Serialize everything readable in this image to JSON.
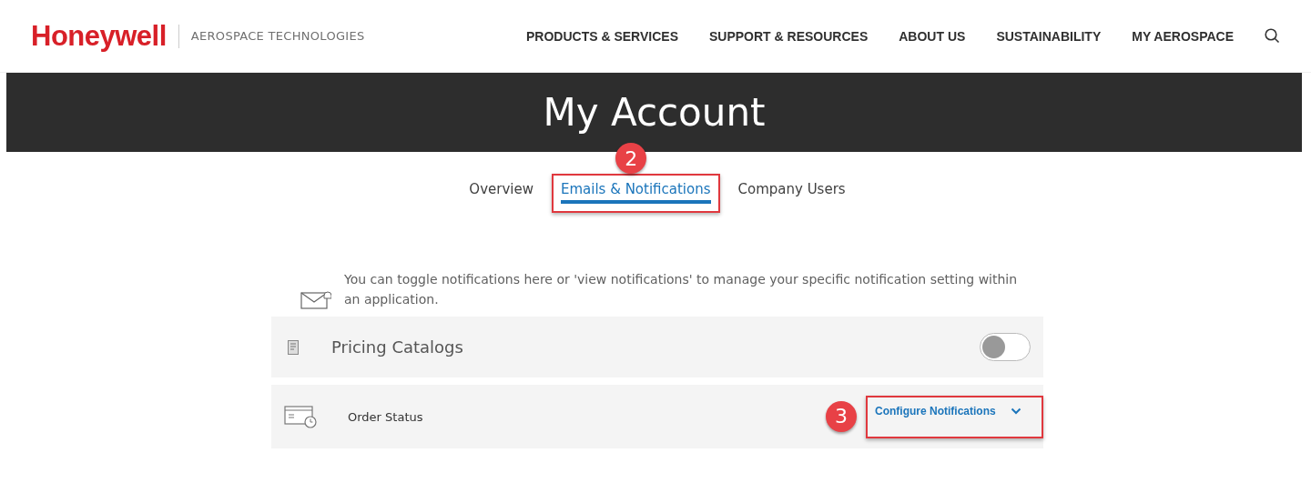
{
  "header": {
    "logo": "Honeywell",
    "division": "AEROSPACE TECHNOLOGIES",
    "nav": [
      "PRODUCTS & SERVICES",
      "SUPPORT & RESOURCES",
      "ABOUT US",
      "SUSTAINABILITY",
      "MY AEROSPACE"
    ]
  },
  "banner": {
    "title": "My Account"
  },
  "tabs": [
    {
      "label": "Overview",
      "selected": false
    },
    {
      "label": "Emails & Notifications",
      "selected": true,
      "callout": "2"
    },
    {
      "label": "Company Users",
      "selected": false
    }
  ],
  "intro": "You can toggle notifications here or 'view notifications' to manage your specific notification setting within an application.",
  "notifications": [
    {
      "kind": "toggle",
      "name": "Pricing Catalogs",
      "on": false
    },
    {
      "kind": "configure",
      "name": "Order Status",
      "link": "Configure Notifications",
      "expanded": false,
      "callout": "3"
    }
  ]
}
